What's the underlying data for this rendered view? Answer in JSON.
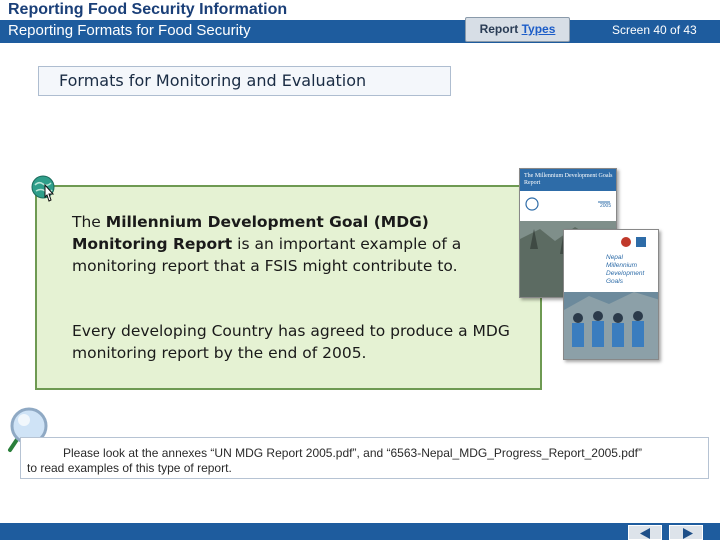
{
  "header": {
    "app_title": "Reporting Food Security Information",
    "module_title": "Reporting Formats for Food Security",
    "report_types_prefix": "Report ",
    "report_types_link": "Types",
    "screen_count": "Screen 40 of 43"
  },
  "section": {
    "title": "Formats for Monitoring and Evaluation"
  },
  "content": {
    "para1_the": "The ",
    "para1_bold": "Millennium Development Goal (MDG) Monitoring Report",
    "para1_rest": " is an important example of a monitoring report that a FSIS might contribute to.",
    "para2": "Every developing Country has agreed to produce a MDG monitoring report by the end of 2005."
  },
  "thumbnails": {
    "report1_title": "The Millennium Development Goals Report",
    "report1_year": "2005",
    "report2_title_line1": "Nepal",
    "report2_title_line2": "Millennium",
    "report2_title_line3": "Development Goals"
  },
  "note": {
    "line1": "Please look at the annexes “UN MDG Report 2005.pdf”, and “6563-Nepal_MDG_Progress_Report_2005.pdf”",
    "line2": "to read examples of this type of report."
  },
  "colors": {
    "header_bar": "#1e5c9e",
    "panel_bg": "#e5f2d3",
    "panel_border": "#6e9a52"
  },
  "icons": {
    "globe": "globe-pointer-icon",
    "magnifier": "magnifier-icon",
    "back": "arrow-left-icon",
    "next": "arrow-right-icon"
  }
}
